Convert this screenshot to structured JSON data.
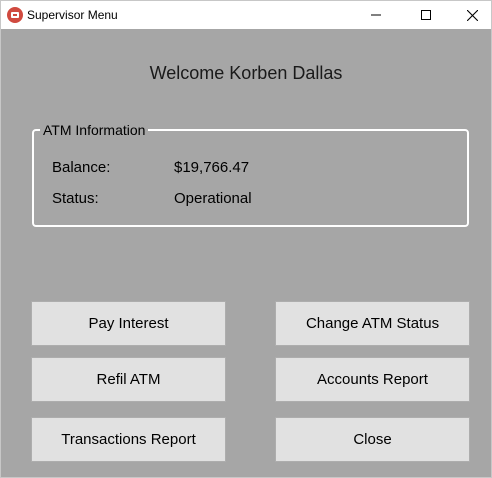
{
  "window": {
    "title": "Supervisor Menu"
  },
  "welcome": "Welcome Korben Dallas",
  "atm_info": {
    "legend": "ATM Information",
    "balance_label": "Balance:",
    "balance_value": "$19,766.47",
    "status_label": "Status:",
    "status_value": "Operational"
  },
  "buttons": {
    "pay_interest": "Pay Interest",
    "change_status": "Change ATM Status",
    "refil": "Refil ATM",
    "accounts_report": "Accounts Report",
    "transactions_report": "Transactions Report",
    "close": "Close"
  },
  "colors": {
    "background": "#a6a6a6",
    "button": "#e1e1e1",
    "icon": "#d04a3f"
  }
}
